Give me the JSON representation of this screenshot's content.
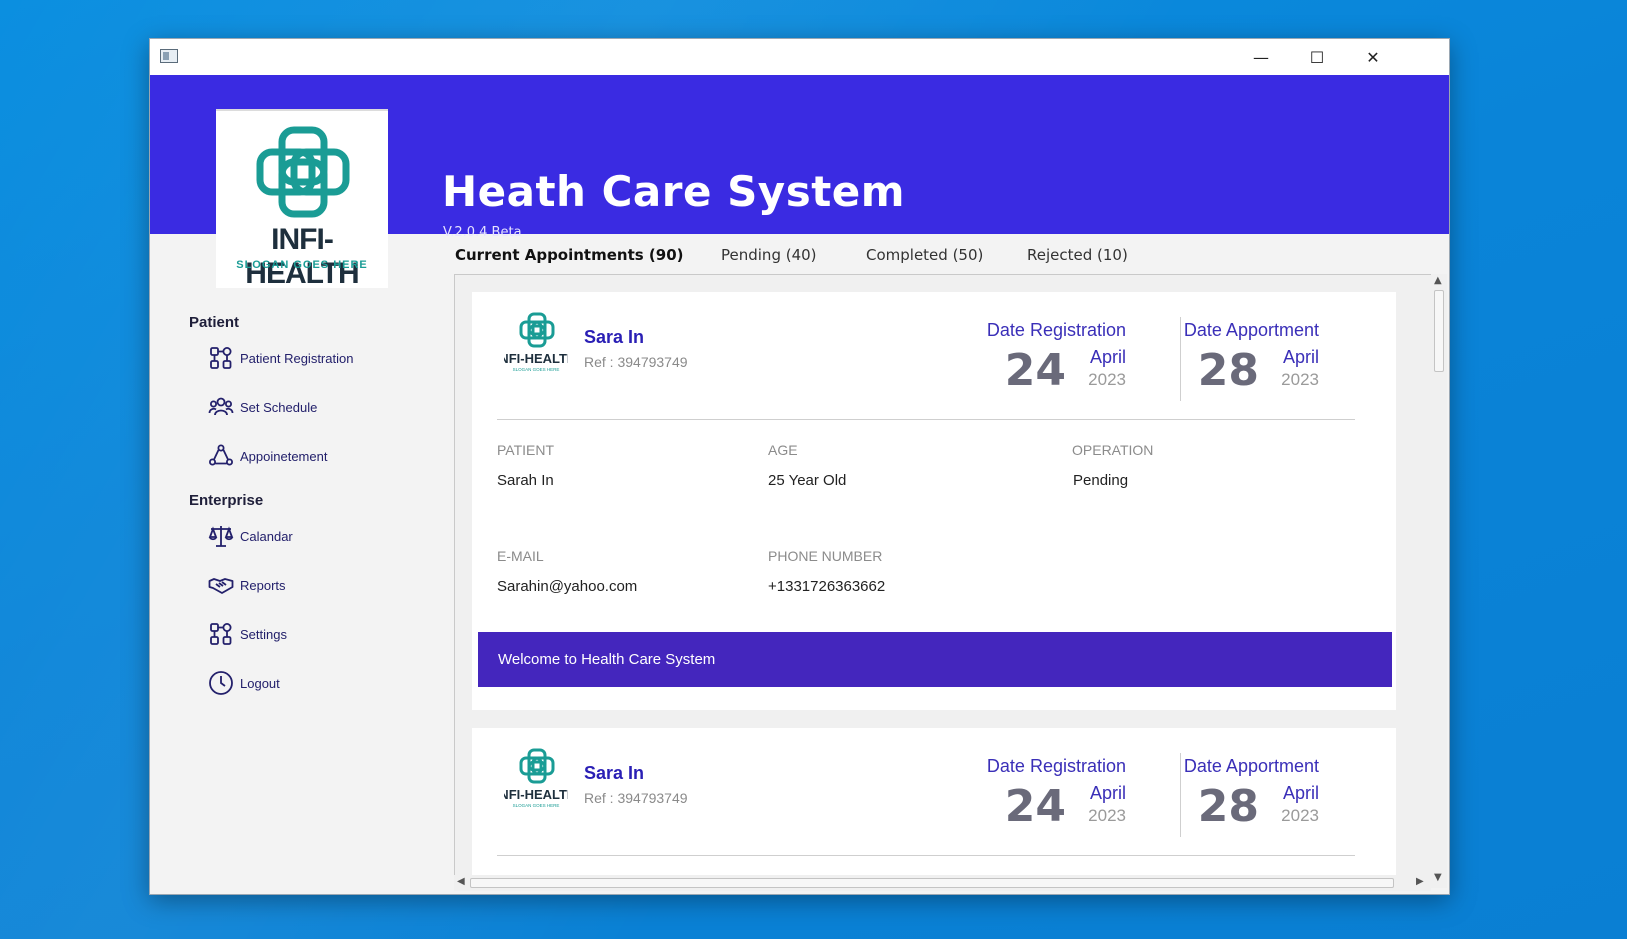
{
  "window": {
    "controls": {
      "minimize": "—",
      "maximize": "☐",
      "close": "✕"
    }
  },
  "header": {
    "title": "Heath Care System",
    "version": "V.2.0.4 Beta",
    "background": "#3a2be2"
  },
  "logo": {
    "brand": "INFI-HEALTH",
    "slogan": "SLOGAN GOES HERE",
    "icon": "medical-cross-icon",
    "colors": {
      "cross": "#1a9c95",
      "brand": "#1e2f3d",
      "slogan": "#1a9c95"
    }
  },
  "sidebar": {
    "sections": [
      {
        "heading": "Patient",
        "items": [
          {
            "label": "Patient Registration",
            "icon": "patient-registration-icon"
          },
          {
            "label": "Set Schedule",
            "icon": "set-schedule-icon"
          },
          {
            "label": "Appoinetement",
            "icon": "appointment-icon"
          }
        ]
      },
      {
        "heading": "Enterprise",
        "items": [
          {
            "label": "Calandar",
            "icon": "scales-icon"
          },
          {
            "label": "Reports",
            "icon": "handshake-icon"
          },
          {
            "label": "Settings",
            "icon": "settings-icon"
          },
          {
            "label": "Logout",
            "icon": "clock-icon"
          }
        ]
      }
    ]
  },
  "tabs": [
    {
      "label": "Current Appointments (90)",
      "active": true
    },
    {
      "label": "Pending (40)",
      "active": false
    },
    {
      "label": "Completed (50)",
      "active": false
    },
    {
      "label": "Rejected (10)",
      "active": false
    }
  ],
  "cards": [
    {
      "name": "Sara In",
      "ref": "Ref : 394793749",
      "registration": {
        "caption": "Date Registration",
        "day": "24",
        "month": "April",
        "year": "2023"
      },
      "appointment": {
        "caption": "Date Apportment",
        "day": "28",
        "month": "April",
        "year": "2023"
      },
      "fields": [
        {
          "label": "PATIENT",
          "value": "Sarah In"
        },
        {
          "label": "AGE",
          "value": "25 Year Old"
        },
        {
          "label": "OPERATION",
          "value": "Pending"
        },
        {
          "label": "E-MAIL",
          "value": "Sarahin@yahoo.com"
        },
        {
          "label": "PHONE NUMBER",
          "value": "+1331726363662"
        }
      ],
      "banner": "Welcome to Health Care System"
    },
    {
      "name": "Sara In",
      "ref": "Ref : 394793749",
      "registration": {
        "caption": "Date Registration",
        "day": "24",
        "month": "April",
        "year": "2023"
      },
      "appointment": {
        "caption": "Date Apportment",
        "day": "28",
        "month": "April",
        "year": "2023"
      }
    }
  ],
  "colors": {
    "accent": "#3a2be2",
    "banner": "#4426bd",
    "name": "#2a1fb5",
    "nav_icon": "#23206b"
  }
}
